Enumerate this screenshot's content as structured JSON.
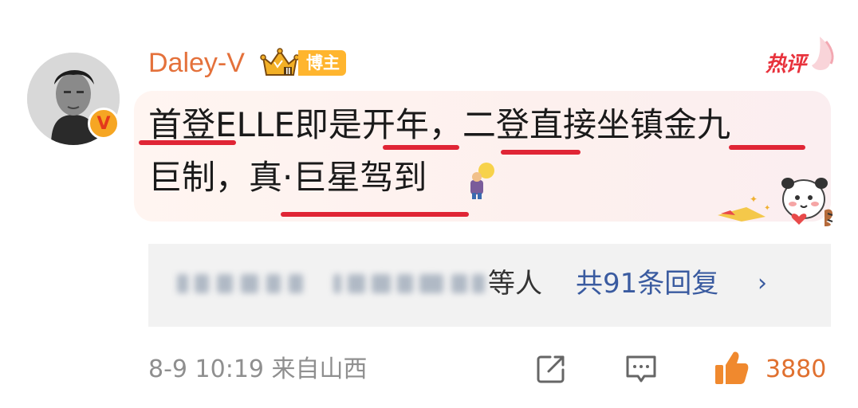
{
  "user": {
    "name": "Daley-V",
    "badge_label": "博主",
    "verified_mark": "V"
  },
  "hot_label": "热评",
  "comment": {
    "segments": [
      "首登",
      "ELLE即是",
      "开年",
      "，",
      "二登",
      "直接坐镇",
      "金九",
      "巨制，",
      "真·",
      "巨星驾到"
    ]
  },
  "replies": {
    "suffix": "等人",
    "count_label": "共91条回复",
    "chevron": "›"
  },
  "footer": {
    "time_source": "8-9 10:19 来自山西",
    "likes": "3880"
  },
  "colors": {
    "username": "#e4713b",
    "underline": "#e02535",
    "link": "#3a5ba0",
    "like": "#e0702f"
  },
  "icons": [
    "crown-icon",
    "flame-icon",
    "share-icon",
    "comment-icon",
    "thumbs-up-icon"
  ]
}
